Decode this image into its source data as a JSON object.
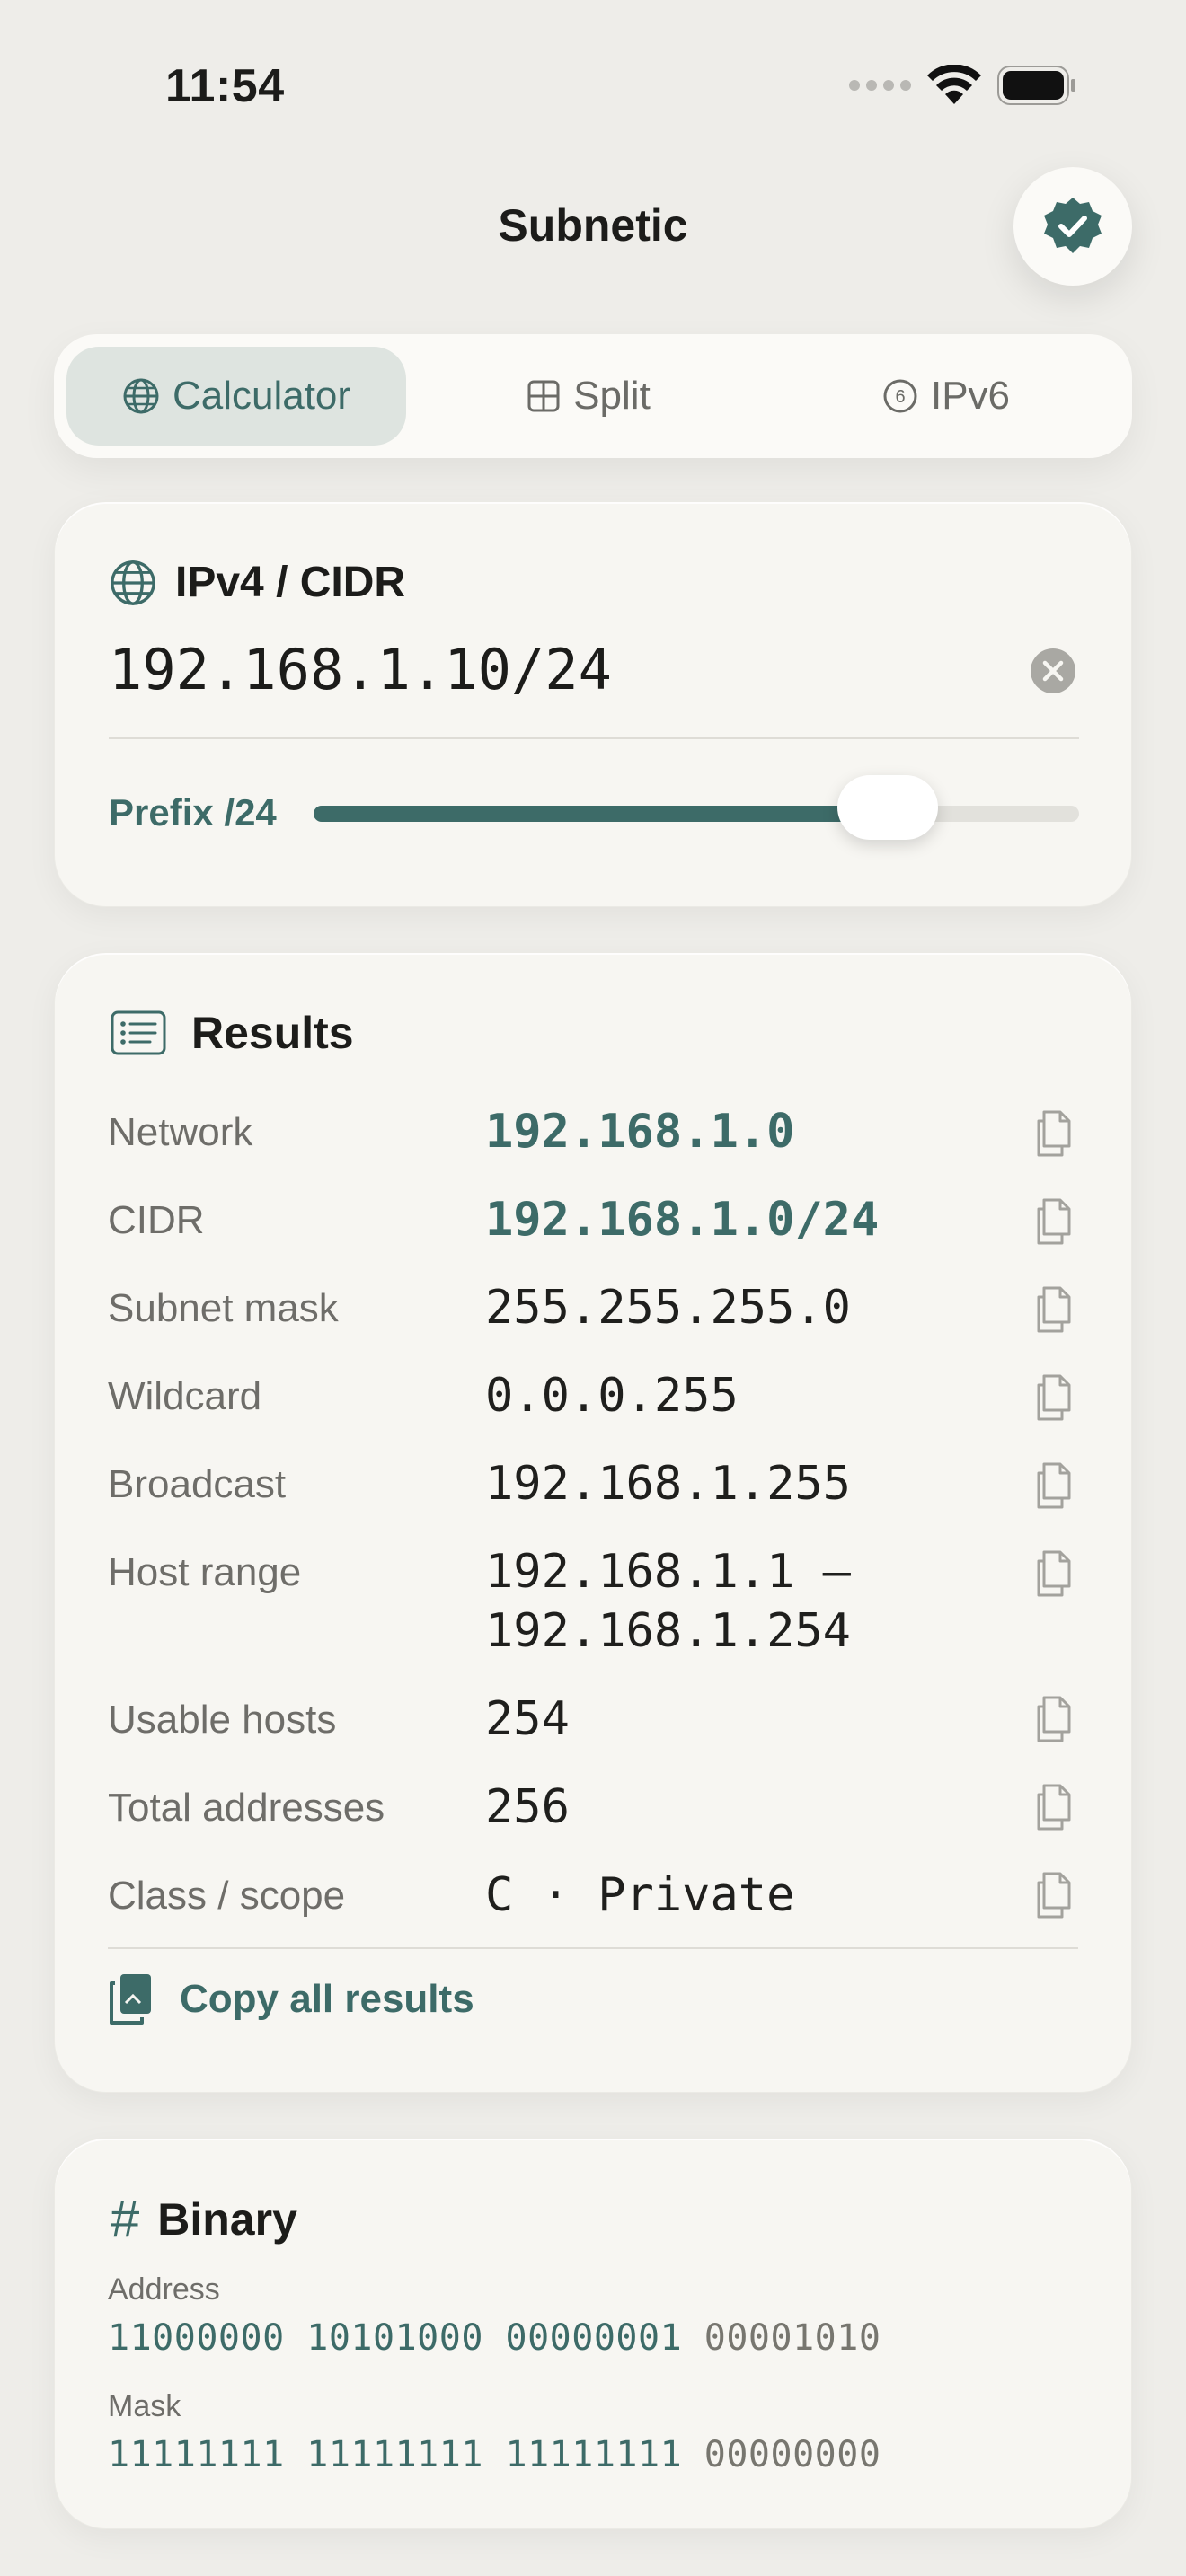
{
  "status_bar": {
    "time": "11:54"
  },
  "header": {
    "title": "Subnetic"
  },
  "tabs": [
    {
      "label": "Calculator",
      "icon": "globe-icon",
      "active": true
    },
    {
      "label": "Split",
      "icon": "grid-icon",
      "active": false
    },
    {
      "label": "IPv6",
      "icon": "six-circle-icon",
      "active": false
    }
  ],
  "input_card": {
    "title": "IPv4 / CIDR",
    "value": "192.168.1.10/24",
    "prefix_label": "Prefix /24",
    "prefix_value": 24,
    "prefix_max": 32
  },
  "results": {
    "title": "Results",
    "rows": [
      {
        "label": "Network",
        "value": "192.168.1.0",
        "accent": true
      },
      {
        "label": "CIDR",
        "value": "192.168.1.0/24",
        "accent": true
      },
      {
        "label": "Subnet mask",
        "value": "255.255.255.0"
      },
      {
        "label": "Wildcard",
        "value": "0.0.0.255"
      },
      {
        "label": "Broadcast",
        "value": "192.168.1.255"
      },
      {
        "label": "Host range",
        "value_line1": "192.168.1.1 –",
        "value_line2": "192.168.1.254"
      },
      {
        "label": "Usable hosts",
        "value": "254"
      },
      {
        "label": "Total addresses",
        "value": "256"
      },
      {
        "label": "Class / scope",
        "value": "C · Private"
      }
    ],
    "copy_all_label": "Copy all results"
  },
  "binary": {
    "title": "Binary",
    "address_label": "Address",
    "address_octets": [
      "11000000",
      "10101000",
      "00000001",
      "00001010"
    ],
    "mask_label": "Mask",
    "mask_octets": [
      "11111111",
      "11111111",
      "11111111",
      "00000000"
    ]
  },
  "colors": {
    "accent": "#3d6b68",
    "background": "#eeede9",
    "card": "#f7f6f2"
  }
}
